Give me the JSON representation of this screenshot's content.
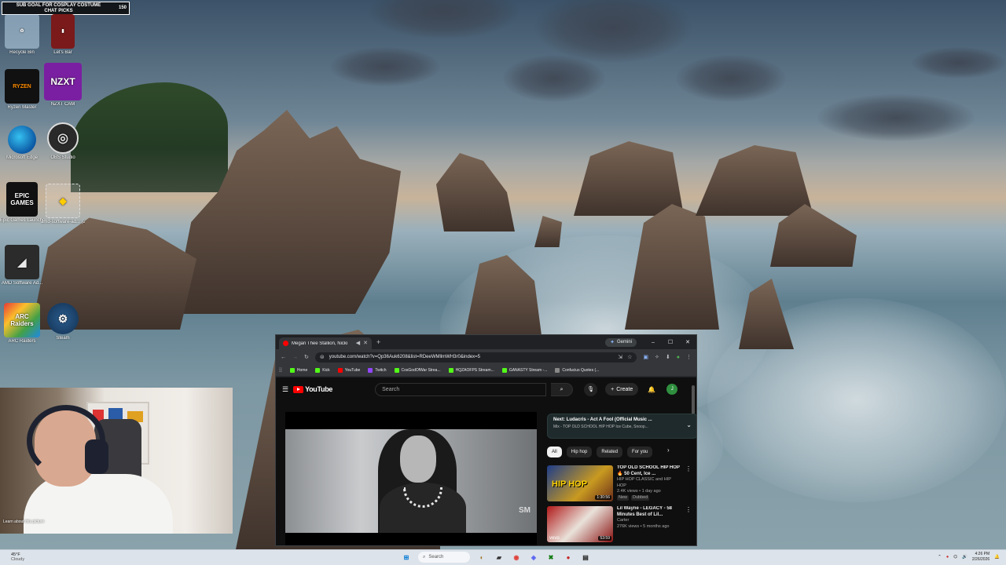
{
  "stream_overlay": {
    "sub_goal_line1": "SUB GOAL FOR COSPLAY COSTUME",
    "sub_goal_line2": "CHAT PICKS",
    "sub_goal_count": "150"
  },
  "desktop": {
    "icons": [
      {
        "label": "Recycle Bin",
        "icon": "recycle-bin-icon"
      },
      {
        "label": "Let's Bar",
        "icon": "app-icon"
      },
      {
        "label": "Ryzen Master",
        "icon": "ryzen-master-icon",
        "tile_text": "RYZEN"
      },
      {
        "label": "NZXT CAM",
        "icon": "nzxt-cam-icon",
        "tile_text": "NZXT"
      },
      {
        "label": "Microsoft Edge",
        "icon": "edge-icon"
      },
      {
        "label": "OBS Studio",
        "icon": "obs-icon"
      },
      {
        "label": "Epic Games Launcher",
        "icon": "epic-games-icon",
        "tile_text": "EPIC GAMES"
      },
      {
        "label": "amd-software-ad... (2)",
        "icon": "installer-icon"
      },
      {
        "label": "AMD Software Ad...",
        "icon": "amd-icon"
      },
      {
        "label": "ARC Raiders",
        "icon": "arc-raiders-icon",
        "tile_text": "ARC Raiders"
      },
      {
        "label": "Steam",
        "icon": "steam-icon"
      }
    ]
  },
  "webcam": {
    "caption": "Learn about this picture"
  },
  "browser": {
    "tab_title": "Megan Thee Stallion, Nicki",
    "gemini_label": "Gemini",
    "url": "youtube.com/watch?v=Qp36Auk6208&list=RDeeWMllmWH3r0&index=5",
    "bookmarks": [
      {
        "label": "Home",
        "color": "#53fc18"
      },
      {
        "label": "Kick",
        "color": "#53fc18"
      },
      {
        "label": "YouTube",
        "color": "#ff0000"
      },
      {
        "label": "Twitch",
        "color": "#9146ff"
      },
      {
        "label": "CosGodOfWar Strea...",
        "color": "#53fc18"
      },
      {
        "label": "HQZAOFPS Stream...",
        "color": "#53fc18"
      },
      {
        "label": "GANASTY Stream -...",
        "color": "#53fc18"
      },
      {
        "label": "Confucius Quotes (...",
        "color": "#888888"
      }
    ]
  },
  "youtube": {
    "logo_text": "YouTube",
    "search_placeholder": "Search",
    "create_label": "Create",
    "avatar_letter": "J",
    "up_next_title": "Next: Ludacris - Act A Fool (Official Music ...",
    "up_next_sub": "Mix - TOP OLD SCHOOL HIP HOP Ice Cube, Snoop...",
    "chips": [
      "All",
      "Hip hop",
      "Related",
      "For you"
    ],
    "video_watermark": "SM",
    "recommendations": [
      {
        "title": "TOP OLD SCHOOL HIP HOP 🔥 50 Cent, Ice ...",
        "channel": "HIP HOP CLASSIC and HIP HOP",
        "meta": "2.4K views • 1 day ago",
        "badges": [
          "New",
          "Dubbed"
        ],
        "duration": "1:30:56",
        "thumb_text": "HIP HOP"
      },
      {
        "title": "Lil Wayne - LEGACY - 58 Minutes Best of Lil...",
        "channel": "Carter",
        "meta": "276K views • 5 months ago",
        "badges": [],
        "duration": "53:59",
        "thumb_text": "vevo"
      }
    ]
  },
  "taskbar": {
    "temp": "45°F",
    "weather": "Cloudy",
    "search_label": "Search",
    "time": "4:26 PM",
    "date": "2/26/2026"
  }
}
